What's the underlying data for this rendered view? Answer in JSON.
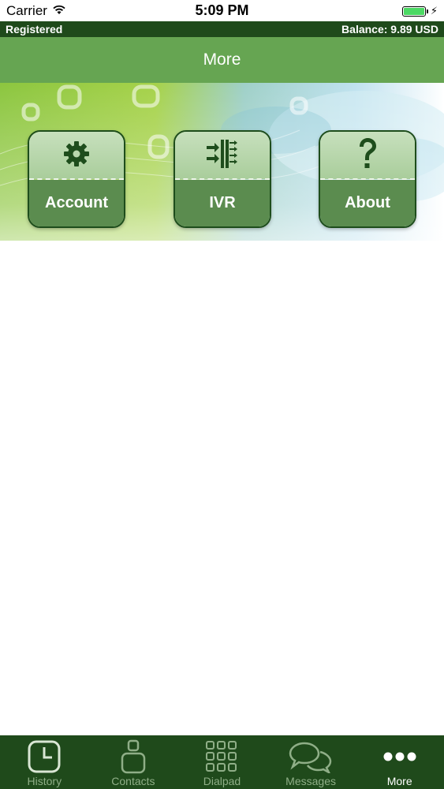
{
  "status_bar": {
    "carrier": "Carrier",
    "time": "5:09 PM"
  },
  "registration": {
    "status": "Registered",
    "balance": "Balance: 9.89 USD"
  },
  "header": {
    "title": "More"
  },
  "tiles": [
    {
      "label": "Account",
      "icon": "gear-icon"
    },
    {
      "label": "IVR",
      "icon": "ivr-icon"
    },
    {
      "label": "About",
      "icon": "question-mark-icon"
    }
  ],
  "tab_bar": {
    "items": [
      {
        "label": "History",
        "icon": "clock-icon",
        "active": false
      },
      {
        "label": "Contacts",
        "icon": "person-icon",
        "active": false
      },
      {
        "label": "Dialpad",
        "icon": "dialpad-icon",
        "active": false
      },
      {
        "label": "Messages",
        "icon": "chat-bubbles-icon",
        "active": false
      },
      {
        "label": "More",
        "icon": "more-dots-icon",
        "active": true
      }
    ]
  },
  "colors": {
    "dark_green": "#1f4a1b",
    "nav_green": "#66a552",
    "tile_light": "#c7e0bd",
    "tile_dark": "#5b8c4f",
    "tab_inactive": "#8fae87"
  }
}
